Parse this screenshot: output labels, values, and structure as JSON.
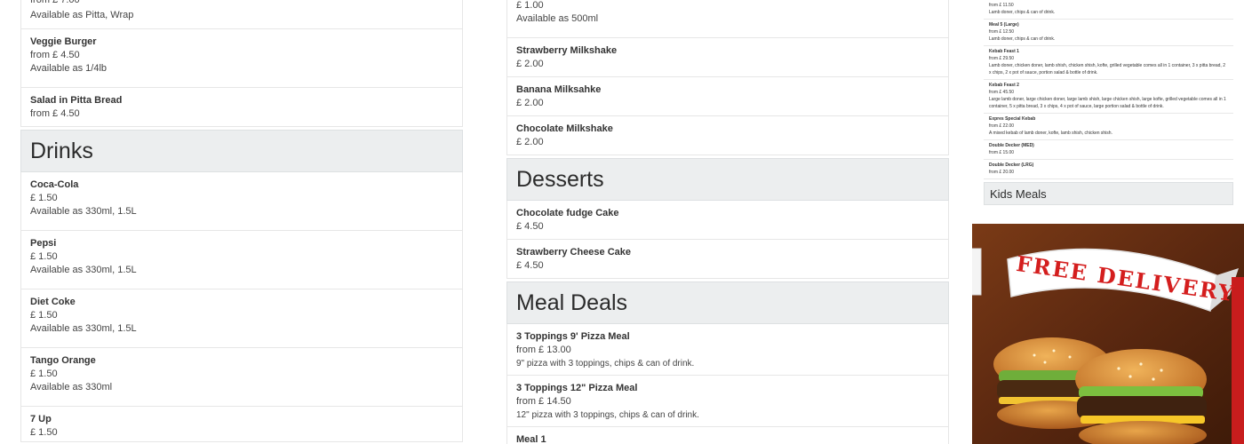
{
  "left": {
    "top_partial": {
      "price": "from £ 7.00",
      "desc": "Available as Pitta, Wrap"
    },
    "items_a": [
      {
        "name": "Veggie Burger",
        "price": "from £ 4.50",
        "desc": "Available as 1/4lb"
      },
      {
        "name": "Salad in Pitta Bread",
        "price": "from £ 4.50",
        "desc": ""
      }
    ],
    "drinks_title": "Drinks",
    "drinks": [
      {
        "name": "Coca-Cola",
        "price": "£ 1.50",
        "desc": "Available as 330ml, 1.5L"
      },
      {
        "name": "Pepsi",
        "price": "£ 1.50",
        "desc": "Available as 330ml, 1.5L"
      },
      {
        "name": "Diet Coke",
        "price": "£ 1.50",
        "desc": "Available as 330ml, 1.5L"
      },
      {
        "name": "Tango Orange",
        "price": "£ 1.50",
        "desc": "Available as 330ml"
      },
      {
        "name": "7 Up",
        "price": "£ 1.50",
        "desc": ""
      }
    ]
  },
  "middle": {
    "top_partial": {
      "price": "£ 1.00",
      "desc": "Available as 500ml"
    },
    "shakes": [
      {
        "name": "Strawberry Milkshake",
        "price": "£ 2.00"
      },
      {
        "name": "Banana Milksahke",
        "price": "£ 2.00"
      },
      {
        "name": "Chocolate Milkshake",
        "price": "£ 2.00"
      }
    ],
    "desserts_title": "Desserts",
    "desserts": [
      {
        "name": "Chocolate fudge Cake",
        "price": "£ 4.50"
      },
      {
        "name": "Strawberry Cheese Cake",
        "price": "£ 4.50"
      }
    ],
    "meal_deals_title": "Meal Deals",
    "meal_deals": [
      {
        "name": "3 Toppings 9' Pizza Meal",
        "price": "from £ 13.00",
        "desc": "9\" pizza with 3 toppings, chips & can of drink."
      },
      {
        "name": "3 Toppings 12\" Pizza Meal",
        "price": "from £ 14.50",
        "desc": "12\" pizza with 3 toppings, chips & can of drink."
      },
      {
        "name": "Meal 1",
        "price": "",
        "desc": ""
      }
    ]
  },
  "right": {
    "top_partial": {
      "price": "from £ 11.50",
      "desc": "Lamb doner, chips & can of drink."
    },
    "items": [
      {
        "name": "Meal 5 (Large)",
        "price": "from £ 12.50",
        "desc": "Lamb doner, chips & can of drink."
      },
      {
        "name": "Kebab Feast 1",
        "price": "from £ 29.50",
        "desc": "Lamb doner, chicken doner, lamb shish, chicken shish, kofte, grilled vegetable comes all in 1 container, 3 x pitta bread, 2 x chips, 2 x pot of sauce, portion salad & bottle of drink."
      },
      {
        "name": "Kebab Feast 2",
        "price": "from £ 45.50",
        "desc": "Large lamb doner, large chicken doner, large lamb shish, large chicken shish, large kofte, grilled vegetable comes all in 1 container, 5 x pitta bread, 3 x chips, 4 x pot of sauce, large portion salad & bottle of drink."
      },
      {
        "name": "Expres Special Kebab",
        "price": "from £ 22.00",
        "desc": "A mixed kebab of lamb doner, kofte, lamb shish, chicken shish."
      },
      {
        "name": "Double Decker (MED)",
        "price": "from £ 15.00",
        "desc": ""
      },
      {
        "name": "Double Decker (LRG)",
        "price": "from £ 20.00",
        "desc": ""
      }
    ],
    "kids_title": "Kids Meals"
  },
  "banner": {
    "text": "FREE DELIVERY"
  }
}
